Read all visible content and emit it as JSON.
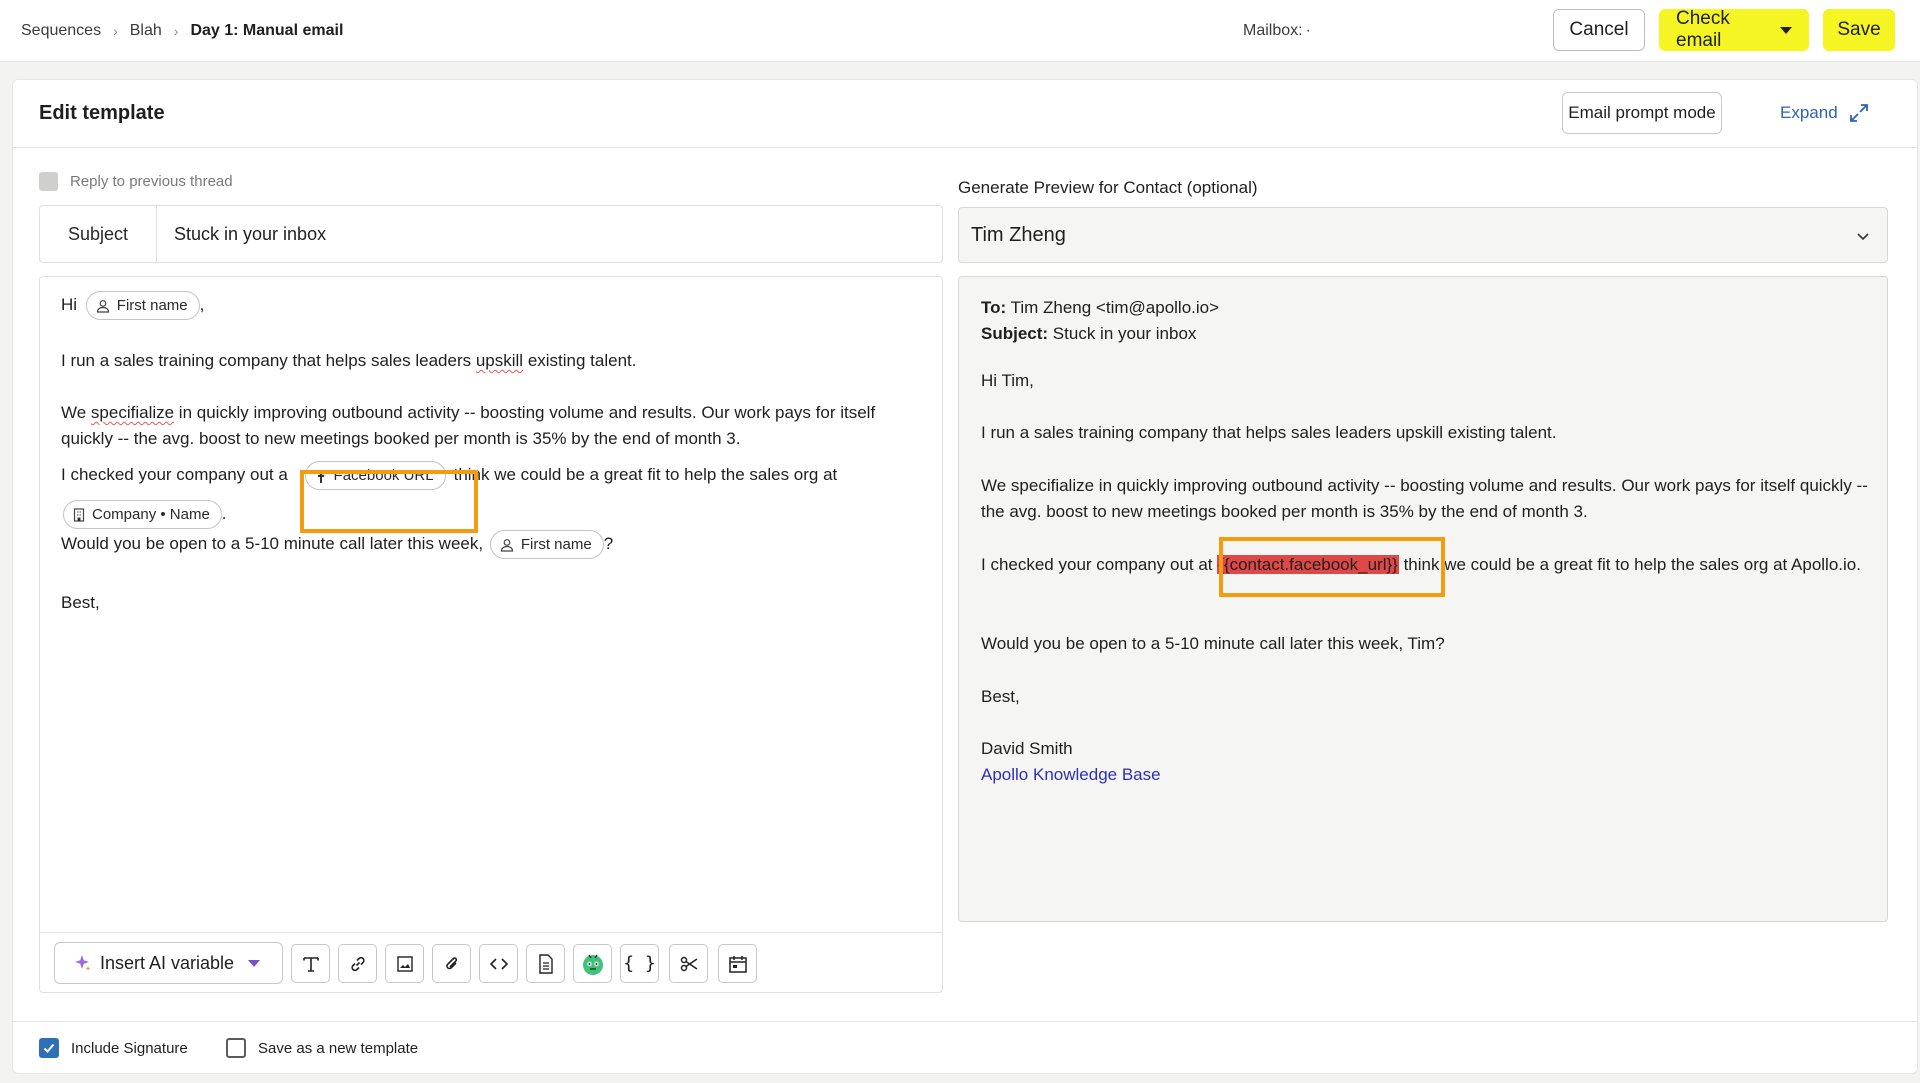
{
  "breadcrumb": {
    "items": [
      "Sequences",
      "Blah"
    ],
    "current": "Day 1: Manual email"
  },
  "mailbox": {
    "label": "Mailbox:",
    "value": "·"
  },
  "header_buttons": {
    "cancel": "Cancel",
    "check_email": "Check email",
    "save": "Save"
  },
  "colors": {
    "accent_yellow": "#f5f523",
    "highlight_orange": "#f39c12",
    "error_red": "#e04848",
    "link_blue": "#2d63b4"
  },
  "panel": {
    "title": "Edit template",
    "prompt_mode": "Email prompt mode",
    "expand": "Expand"
  },
  "editor": {
    "reply_to_thread": "Reply to previous thread",
    "subject_label": "Subject",
    "subject_value": "Stuck in your inbox",
    "greeting_prefix": "Hi",
    "chip_first_name": "First name",
    "greeting_suffix": ",",
    "p1_a": "I run a sales training company that helps sales leaders ",
    "p1_squiggle": "upskill",
    "p1_b": " existing talent.",
    "p2_a": "We ",
    "p2_squiggle": "specifialize",
    "p2_b": " in quickly improving outbound activity -- boosting volume and results. Our work pays for itself quickly -- the avg. boost to new meetings booked per month is 35% by the end of month 3.",
    "p3_a": "I checked your company out a",
    "chip_facebook": "Facebook URL",
    "p3_b": "think we could be a great fit to help the sales org at",
    "chip_company": "Company • Name",
    "p3_c": ".",
    "p4_a": "Would you be open to a 5-10 minute call later this week,",
    "chip_first_name_2": "First name",
    "p4_b": "?",
    "closing": "Best,",
    "insert_ai_variable": "Insert AI variable",
    "toolbar_icons": [
      "text-format-icon",
      "link-icon",
      "image-icon",
      "attachment-icon",
      "code-icon",
      "document-icon",
      "bot-icon",
      "variable-braces-icon",
      "scissors-icon",
      "calendar-icon"
    ]
  },
  "footer": {
    "include_signature": "Include Signature",
    "include_signature_checked": true,
    "save_as_template": "Save as a new template",
    "save_as_template_checked": false
  },
  "preview": {
    "label": "Generate Preview for Contact (optional)",
    "contact": "Tim Zheng",
    "to_label": "To:",
    "to_value": "Tim Zheng <tim@apollo.io>",
    "subject_label": "Subject:",
    "subject_value": "Stuck in your inbox",
    "greeting": "Hi Tim,",
    "p1": "I run a sales training company that helps sales leaders upskill existing talent.",
    "p2": "We specifialize in quickly improving outbound activity -- boosting volume and results. Our work pays for itself quickly -- the avg. boost to new meetings booked per month is 35% by the end of month 3.",
    "p3_a": "I checked your company out at ",
    "p3_var": "{{contact.facebook_url}}",
    "p3_b": " think we could be a great fit to help the sales org at Apollo.io.",
    "p4": "Would you be open to a 5-10 minute call later this week, Tim?",
    "closing": "Best,",
    "signature_name": "David Smith",
    "signature_link": "Apollo Knowledge Base"
  }
}
